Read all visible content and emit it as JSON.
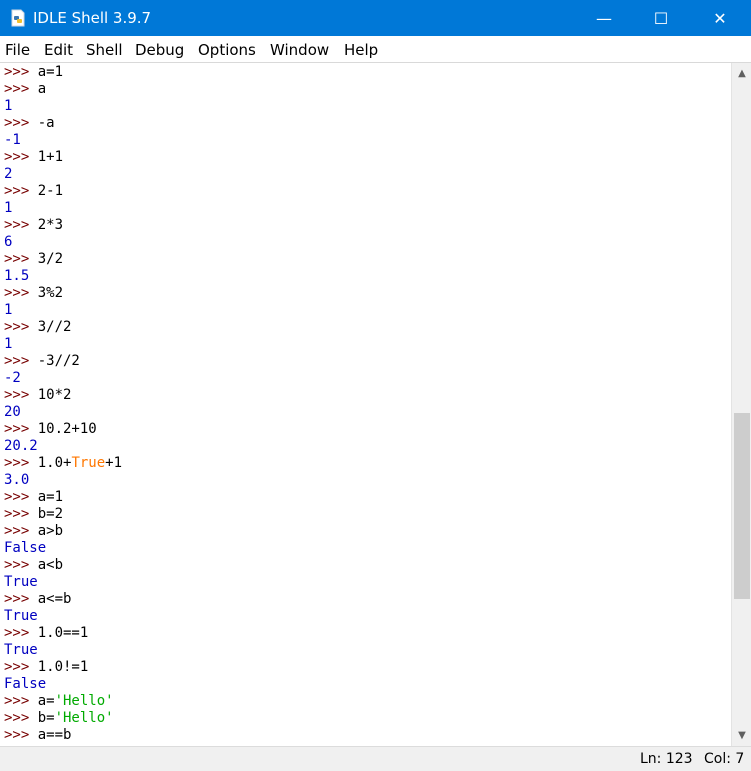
{
  "window": {
    "title": "IDLE Shell 3.9.7",
    "controls": {
      "minimize": "—",
      "maximize": "☐",
      "close": "✕"
    }
  },
  "menubar": [
    "File",
    "Edit",
    "Shell",
    "Debug",
    "Options",
    "Window",
    "Help"
  ],
  "colors": {
    "titlebar": "#0078d7",
    "prompt": "#770000",
    "output": "#0000c0",
    "keyword": "#ff7700",
    "string": "#00aa00"
  },
  "shell": {
    "lines": [
      {
        "type": "input",
        "prompt": ">>> ",
        "parts": [
          {
            "t": "a=1",
            "c": "input"
          }
        ]
      },
      {
        "type": "input",
        "prompt": ">>> ",
        "parts": [
          {
            "t": "a",
            "c": "input"
          }
        ]
      },
      {
        "type": "output",
        "parts": [
          {
            "t": "1",
            "c": "output"
          }
        ]
      },
      {
        "type": "input",
        "prompt": ">>> ",
        "parts": [
          {
            "t": "-a",
            "c": "input"
          }
        ]
      },
      {
        "type": "output",
        "parts": [
          {
            "t": "-1",
            "c": "output"
          }
        ]
      },
      {
        "type": "input",
        "prompt": ">>> ",
        "parts": [
          {
            "t": "1+1",
            "c": "input"
          }
        ]
      },
      {
        "type": "output",
        "parts": [
          {
            "t": "2",
            "c": "output"
          }
        ]
      },
      {
        "type": "input",
        "prompt": ">>> ",
        "parts": [
          {
            "t": "2-1",
            "c": "input"
          }
        ]
      },
      {
        "type": "output",
        "parts": [
          {
            "t": "1",
            "c": "output"
          }
        ]
      },
      {
        "type": "input",
        "prompt": ">>> ",
        "parts": [
          {
            "t": "2*3",
            "c": "input"
          }
        ]
      },
      {
        "type": "output",
        "parts": [
          {
            "t": "6",
            "c": "output"
          }
        ]
      },
      {
        "type": "input",
        "prompt": ">>> ",
        "parts": [
          {
            "t": "3/2",
            "c": "input"
          }
        ]
      },
      {
        "type": "output",
        "parts": [
          {
            "t": "1.5",
            "c": "output"
          }
        ]
      },
      {
        "type": "input",
        "prompt": ">>> ",
        "parts": [
          {
            "t": "3%2",
            "c": "input"
          }
        ]
      },
      {
        "type": "output",
        "parts": [
          {
            "t": "1",
            "c": "output"
          }
        ]
      },
      {
        "type": "input",
        "prompt": ">>> ",
        "parts": [
          {
            "t": "3//2",
            "c": "input"
          }
        ]
      },
      {
        "type": "output",
        "parts": [
          {
            "t": "1",
            "c": "output"
          }
        ]
      },
      {
        "type": "input",
        "prompt": ">>> ",
        "parts": [
          {
            "t": "-3//2",
            "c": "input"
          }
        ]
      },
      {
        "type": "output",
        "parts": [
          {
            "t": "-2",
            "c": "output"
          }
        ]
      },
      {
        "type": "input",
        "prompt": ">>> ",
        "parts": [
          {
            "t": "10*2",
            "c": "input"
          }
        ]
      },
      {
        "type": "output",
        "parts": [
          {
            "t": "20",
            "c": "output"
          }
        ]
      },
      {
        "type": "input",
        "prompt": ">>> ",
        "parts": [
          {
            "t": "10.2+10",
            "c": "input"
          }
        ]
      },
      {
        "type": "output",
        "parts": [
          {
            "t": "20.2",
            "c": "output"
          }
        ]
      },
      {
        "type": "input",
        "prompt": ">>> ",
        "parts": [
          {
            "t": "1.0+",
            "c": "input"
          },
          {
            "t": "True",
            "c": "kw"
          },
          {
            "t": "+1",
            "c": "input"
          }
        ]
      },
      {
        "type": "output",
        "parts": [
          {
            "t": "3.0",
            "c": "output"
          }
        ]
      },
      {
        "type": "input",
        "prompt": ">>> ",
        "parts": [
          {
            "t": "a=1",
            "c": "input"
          }
        ]
      },
      {
        "type": "input",
        "prompt": ">>> ",
        "parts": [
          {
            "t": "b=2",
            "c": "input"
          }
        ]
      },
      {
        "type": "input",
        "prompt": ">>> ",
        "parts": [
          {
            "t": "a>b",
            "c": "input"
          }
        ]
      },
      {
        "type": "output",
        "parts": [
          {
            "t": "False",
            "c": "output"
          }
        ]
      },
      {
        "type": "input",
        "prompt": ">>> ",
        "parts": [
          {
            "t": "a<b",
            "c": "input"
          }
        ]
      },
      {
        "type": "output",
        "parts": [
          {
            "t": "True",
            "c": "output"
          }
        ]
      },
      {
        "type": "input",
        "prompt": ">>> ",
        "parts": [
          {
            "t": "a<=b",
            "c": "input"
          }
        ]
      },
      {
        "type": "output",
        "parts": [
          {
            "t": "True",
            "c": "output"
          }
        ]
      },
      {
        "type": "input",
        "prompt": ">>> ",
        "parts": [
          {
            "t": "1.0==1",
            "c": "input"
          }
        ]
      },
      {
        "type": "output",
        "parts": [
          {
            "t": "True",
            "c": "output"
          }
        ]
      },
      {
        "type": "input",
        "prompt": ">>> ",
        "parts": [
          {
            "t": "1.0!=1",
            "c": "input"
          }
        ]
      },
      {
        "type": "output",
        "parts": [
          {
            "t": "False",
            "c": "output"
          }
        ]
      },
      {
        "type": "input",
        "prompt": ">>> ",
        "parts": [
          {
            "t": "a=",
            "c": "input"
          },
          {
            "t": "'Hello'",
            "c": "str"
          }
        ]
      },
      {
        "type": "input",
        "prompt": ">>> ",
        "parts": [
          {
            "t": "b=",
            "c": "input"
          },
          {
            "t": "'Hello'",
            "c": "str"
          }
        ]
      },
      {
        "type": "input",
        "prompt": ">>> ",
        "parts": [
          {
            "t": "a==b",
            "c": "input"
          }
        ]
      }
    ]
  },
  "statusbar": {
    "ln": "Ln: 123",
    "col": "Col: 7"
  }
}
